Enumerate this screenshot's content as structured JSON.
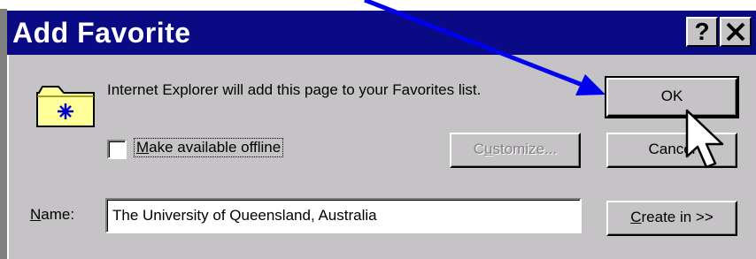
{
  "window": {
    "title": "Add Favorite",
    "help_glyph": "?",
    "close_glyph": "✕"
  },
  "dialog": {
    "message": "Internet Explorer will add this page to your Favorites list.",
    "offline": {
      "checked": false,
      "label_mnemonic": "M",
      "label_rest": "ake available offline"
    },
    "name": {
      "label_mnemonic": "N",
      "label_rest": "ame:",
      "value": "The University of Queensland, Australia"
    },
    "buttons": {
      "ok": "OK",
      "cancel": "Cancel",
      "customize_pre": "C",
      "customize_mnemonic": "u",
      "customize_post": "stomize...",
      "createin_mnemonic": "C",
      "createin_rest": "reate in >>"
    }
  },
  "icons": {
    "folder": "folder-star-icon",
    "annotation_arrow": "blue-arrow",
    "cursor": "mouse-pointer-icon"
  },
  "colors": {
    "titlebar": "#0a0a84",
    "dialog_face": "#c6c3c6",
    "annotation_arrow": "#0000ee",
    "folder_fill": "#ffff99"
  }
}
